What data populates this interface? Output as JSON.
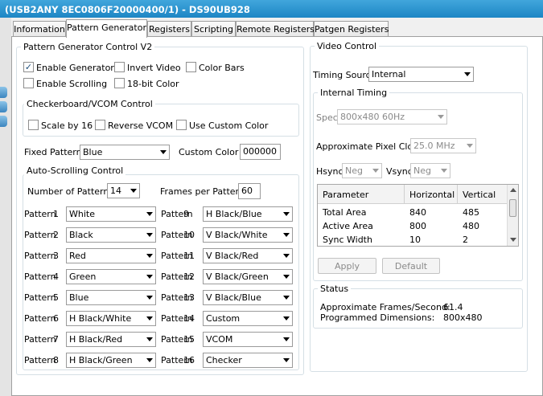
{
  "window": {
    "title": "(USB2ANY 8EC0806F20000400/1) - DS90UB928"
  },
  "tabs": [
    "Information",
    "Pattern Generator",
    "Registers",
    "Scripting",
    "Remote Registers",
    "Patgen Registers"
  ],
  "pgc": {
    "title": "Pattern Generator Control V2",
    "enable_generator": "Enable Generator",
    "invert_video": "Invert Video",
    "color_bars": "Color Bars",
    "enable_scrolling": "Enable Scrolling",
    "bit18_color": "18-bit Color",
    "checkerboard": {
      "title": "Checkerboard/VCOM Control",
      "scale": "Scale by 16",
      "reverse": "Reverse VCOM",
      "custom": "Use Custom Color"
    },
    "fixed_pattern_label": "Fixed Pattern",
    "fixed_pattern_value": "Blue",
    "custom_color_label": "Custom Color #",
    "custom_color_value": "000000",
    "autoscroll": {
      "title": "Auto-Scrolling Control",
      "num_patterns_label": "Number of Patterns",
      "num_patterns_value": "14",
      "fpp_label": "Frames per Pattern",
      "fpp_value": "60"
    },
    "pattern_label": "Pattern",
    "patterns": [
      {
        "num": "1",
        "value": "White"
      },
      {
        "num": "2",
        "value": "Black"
      },
      {
        "num": "3",
        "value": "Red"
      },
      {
        "num": "4",
        "value": "Green"
      },
      {
        "num": "5",
        "value": "Blue"
      },
      {
        "num": "6",
        "value": "H Black/White"
      },
      {
        "num": "7",
        "value": "H Black/Red"
      },
      {
        "num": "8",
        "value": "H Black/Green"
      },
      {
        "num": "9",
        "value": "H Black/Blue"
      },
      {
        "num": "10",
        "value": "V Black/White"
      },
      {
        "num": "11",
        "value": "V Black/Red"
      },
      {
        "num": "12",
        "value": "V Black/Green"
      },
      {
        "num": "13",
        "value": "V Black/Blue"
      },
      {
        "num": "14",
        "value": "Custom"
      },
      {
        "num": "15",
        "value": "VCOM"
      },
      {
        "num": "16",
        "value": "Checker"
      }
    ]
  },
  "video": {
    "title": "Video Control",
    "timing_source_label": "Timing Source",
    "timing_source_value": "Internal",
    "internal_timing": {
      "title": "Internal Timing",
      "spec_label": "Spec",
      "spec_value": "800x480 60Hz",
      "pixel_clock_label": "Approximate Pixel Clock",
      "pixel_clock_value": "25.0 MHz",
      "hsync_label": "Hsync",
      "hsync_value": "Neg",
      "vsync_label": "Vsync",
      "vsync_value": "Neg",
      "table_headers": [
        "Parameter",
        "Horizontal",
        "Vertical"
      ],
      "table_rows": [
        [
          "Total Area",
          "840",
          "485"
        ],
        [
          "Active Area",
          "800",
          "480"
        ],
        [
          "Sync Width",
          "10",
          "2"
        ]
      ],
      "apply": "Apply",
      "default": "Default"
    }
  },
  "status": {
    "title": "Status",
    "fps_label": "Approximate Frames/Second:",
    "fps_value": "61.4",
    "dims_label": "Programmed Dimensions:",
    "dims_value": "800x480"
  },
  "colors": {
    "titlebar": "#2a93cf",
    "accent": "#1d4d7a"
  }
}
